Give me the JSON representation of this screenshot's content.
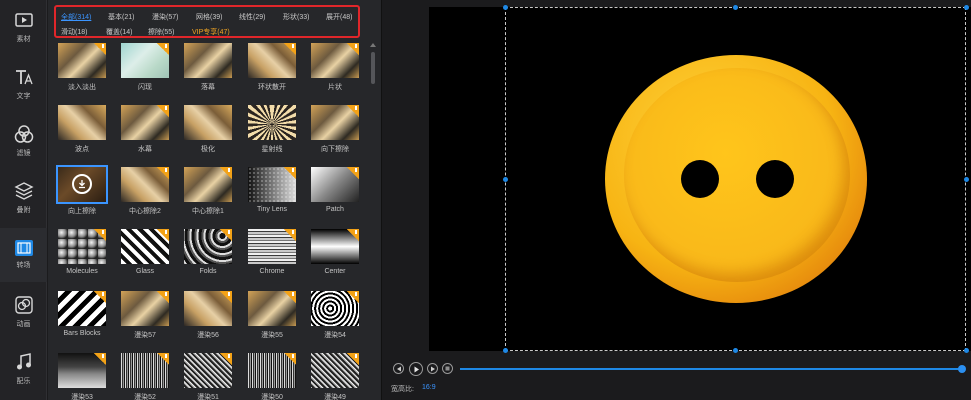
{
  "rail": {
    "items": [
      {
        "label": "素材",
        "icon": "folder-play-icon"
      },
      {
        "label": "文字",
        "icon": "text-icon"
      },
      {
        "label": "滤镜",
        "icon": "filter-icon"
      },
      {
        "label": "叠附",
        "icon": "layers-icon"
      },
      {
        "label": "转场",
        "icon": "transition-icon"
      },
      {
        "label": "动画",
        "icon": "animation-icon"
      },
      {
        "label": "配乐",
        "icon": "music-note-icon"
      }
    ]
  },
  "categories": {
    "row1": [
      "全部(314)",
      "基本(21)",
      "漫染(57)",
      "网格(39)",
      "线性(29)",
      "形状(33)",
      "展开(48)"
    ],
    "row2": [
      "滑动(18)",
      "覆盖(14)",
      "擦除(55)",
      "VIP专享(47)"
    ]
  },
  "tiles": [
    {
      "label": "淡入淡出",
      "style": "t-photo",
      "badge": true
    },
    {
      "label": "闪现",
      "style": "t-soft",
      "badge": true
    },
    {
      "label": "落幕",
      "style": "t-photo",
      "badge": false
    },
    {
      "label": "环状散开",
      "style": "t-photo2",
      "badge": true
    },
    {
      "label": "片状",
      "style": "t-photo",
      "badge": true
    },
    {
      "label": "波点",
      "style": "t-photo2",
      "badge": false
    },
    {
      "label": "水幕",
      "style": "t-photo",
      "badge": true
    },
    {
      "label": "极化",
      "style": "t-photo2",
      "badge": false
    },
    {
      "label": "星射线",
      "style": "t-rays",
      "badge": false
    },
    {
      "label": "向下擦除",
      "style": "t-photo",
      "badge": true
    },
    {
      "label": "向上擦除",
      "style": "t-photo",
      "badge": false
    },
    {
      "label": "中心擦除2",
      "style": "t-photo2",
      "badge": true
    },
    {
      "label": "中心擦除1",
      "style": "t-photo",
      "badge": true
    },
    {
      "label": "Tiny Lens",
      "style": "t-tiny",
      "badge": true
    },
    {
      "label": "Patch",
      "style": "t-gradient-patch",
      "badge": true
    },
    {
      "label": "Molecules",
      "style": "t-molecules",
      "badge": true
    },
    {
      "label": "Glass",
      "style": "t-glass",
      "badge": true
    },
    {
      "label": "Folds",
      "style": "t-folds",
      "badge": true
    },
    {
      "label": "Chrome",
      "style": "t-chrome",
      "badge": true
    },
    {
      "label": "Center",
      "style": "t-center",
      "badge": true
    },
    {
      "label": "Bars Blocks",
      "style": "t-bars",
      "badge": true
    },
    {
      "label": "漫染57",
      "style": "t-photo",
      "badge": true
    },
    {
      "label": "漫染56",
      "style": "t-photo2",
      "badge": true
    },
    {
      "label": "漫染55",
      "style": "t-photo",
      "badge": true
    },
    {
      "label": "漫染54",
      "style": "t-zebra",
      "badge": true
    },
    {
      "label": "漫染53",
      "style": "t-steps",
      "badge": true
    },
    {
      "label": "漫染52",
      "style": "t-noise",
      "badge": true
    },
    {
      "label": "漫染51",
      "style": "t-noise2",
      "badge": true
    },
    {
      "label": "漫染50",
      "style": "t-noise",
      "badge": true
    },
    {
      "label": "漫染49",
      "style": "t-noise2",
      "badge": true
    }
  ],
  "preview": {
    "ratio_label": "宽高比:",
    "ratio_value": "16:9",
    "progress": 1.0
  },
  "colors": {
    "accent": "#1e88e5",
    "category_selected": "#3b95ff",
    "vip": "#f0a422",
    "highlight_box": "#e0262a",
    "badge": "#f3a217"
  }
}
